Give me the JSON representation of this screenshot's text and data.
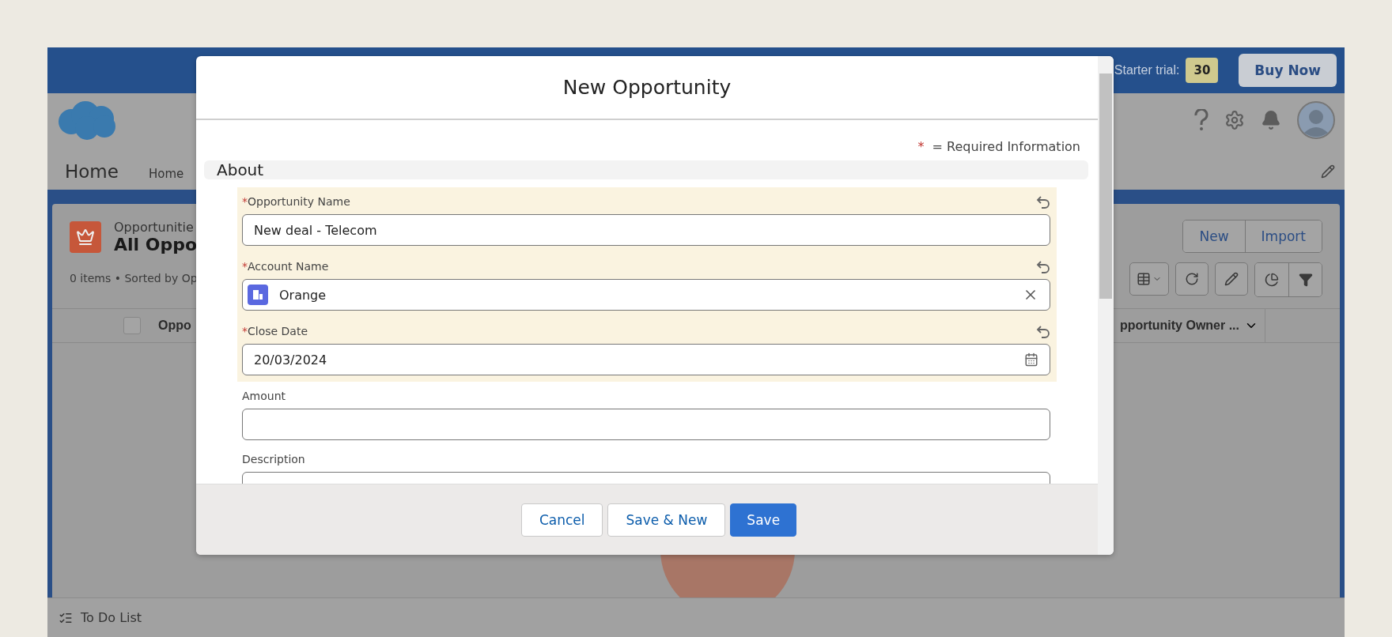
{
  "top_bar": {
    "trial_label": "Starter trial:",
    "trial_days": "30",
    "buy_button": "Buy Now"
  },
  "header": {
    "app_name": "Home",
    "nav_items": [
      {
        "label": "Home"
      }
    ]
  },
  "list_view": {
    "object_label": "Opportunitie",
    "title": "All Oppo",
    "summary": "0 items • Sorted by Op",
    "buttons": [
      "New",
      "Import"
    ],
    "select_all_checked": false,
    "columns": [
      "Oppo",
      "pportunity Owner ..."
    ]
  },
  "modal": {
    "title": "New Opportunity",
    "required_mark": "*",
    "required_note": "= Required Information",
    "section": "About",
    "fields": [
      {
        "kind": "text",
        "label": "Opportunity Name",
        "mark": "*",
        "edited": true,
        "value": "New deal - Telecom"
      },
      {
        "kind": "lookup",
        "label": "Account Name",
        "mark": "*",
        "edited": true,
        "value": "Orange"
      },
      {
        "kind": "date",
        "label": "Close Date",
        "mark": "*",
        "edited": true,
        "value": "20/03/2024"
      },
      {
        "kind": "text",
        "label": "Amount",
        "edited": false
      },
      {
        "kind": "textarea",
        "label": "Description",
        "edited": false
      }
    ],
    "buttons": [
      {
        "label": "Cancel",
        "kind": "neutral"
      },
      {
        "label": "Save & New",
        "kind": "neutral"
      },
      {
        "label": "Save",
        "kind": "brand"
      }
    ]
  },
  "utility_bar": {
    "item": "To Do List"
  }
}
